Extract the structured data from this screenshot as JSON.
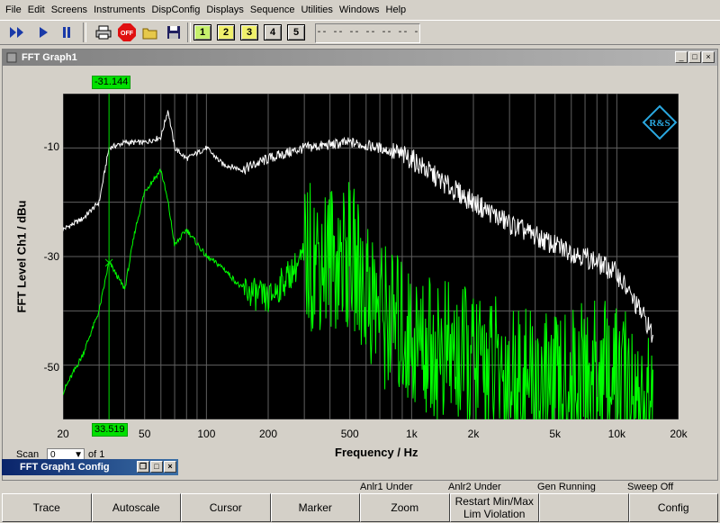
{
  "menu": [
    "File",
    "Edit",
    "Screens",
    "Instruments",
    "DispConfig",
    "Displays",
    "Sequence",
    "Utilities",
    "Windows",
    "Help"
  ],
  "toolbar": {
    "numbers": [
      "1",
      "2",
      "3",
      "4",
      "5"
    ],
    "readout": "-- -- -- -- -- -- --",
    "off_label": "OFF"
  },
  "graph_window": {
    "title": "FFT Graph1"
  },
  "config_window": {
    "title": "FFT Graph1 Config"
  },
  "scan": {
    "label": "Scan",
    "value": "0",
    "suffix": "of 1"
  },
  "cursor": {
    "level": "-31.144",
    "freq": "33.519"
  },
  "status": {
    "anlr1": "Anlr1 Under",
    "anlr2": "Anlr2 Under",
    "gen": "Gen Running",
    "sweep": "Sweep Off"
  },
  "softkeys": [
    "Trace",
    "Autoscale",
    "Cursor",
    "Marker",
    "Zoom",
    "Restart Min/Max Lim Violation",
    "",
    "Config"
  ],
  "chart_data": {
    "type": "line",
    "xlabel": "Frequency / Hz",
    "ylabel": "FFT Level Ch1 / dBu",
    "xscale": "log",
    "xlim": [
      20,
      20000
    ],
    "ylim": [
      -60,
      0
    ],
    "xticks": [
      "20",
      "50",
      "100",
      "200",
      "500",
      "1k",
      "2k",
      "5k",
      "10k",
      "20k"
    ],
    "yticks": [
      "-10",
      "-30",
      "-50"
    ],
    "grid": true,
    "colors": {
      "trace_max": "#ffffff",
      "trace_ch1": "#00ff00",
      "background": "#000000",
      "grid": "#606060"
    },
    "series": [
      {
        "color": "#ffffff",
        "x": [
          20,
          25,
          30,
          33.5,
          40,
          50,
          60,
          65,
          70,
          80,
          100,
          120,
          150,
          200,
          300,
          500,
          700,
          1000,
          1500,
          2000,
          3000,
          5000,
          7000,
          10000,
          12000,
          14000,
          15000
        ],
        "y": [
          -25,
          -23,
          -20,
          -10,
          -9,
          -9,
          -8,
          -3,
          -10,
          -12,
          -10,
          -13,
          -14,
          -12,
          -10,
          -9,
          -10,
          -12,
          -17,
          -20,
          -24,
          -28,
          -30,
          -33,
          -38,
          -42,
          -45
        ]
      },
      {
        "color": "#00ff00",
        "x": [
          20,
          25,
          30,
          33.5,
          40,
          45,
          50,
          60,
          65,
          70,
          80,
          100,
          120,
          150,
          200,
          300,
          500,
          700,
          1000,
          1500,
          2000,
          3000,
          5000,
          7000,
          10000,
          12000,
          14000,
          15000
        ],
        "y": [
          -55,
          -48,
          -40,
          -31,
          -36,
          -25,
          -18,
          -14,
          -20,
          -28,
          -25,
          -30,
          -32,
          -36,
          -38,
          -30,
          -30,
          -40,
          -45,
          -48,
          -50,
          -52,
          -55,
          -52,
          -52,
          -56,
          -58,
          -60
        ]
      }
    ]
  }
}
